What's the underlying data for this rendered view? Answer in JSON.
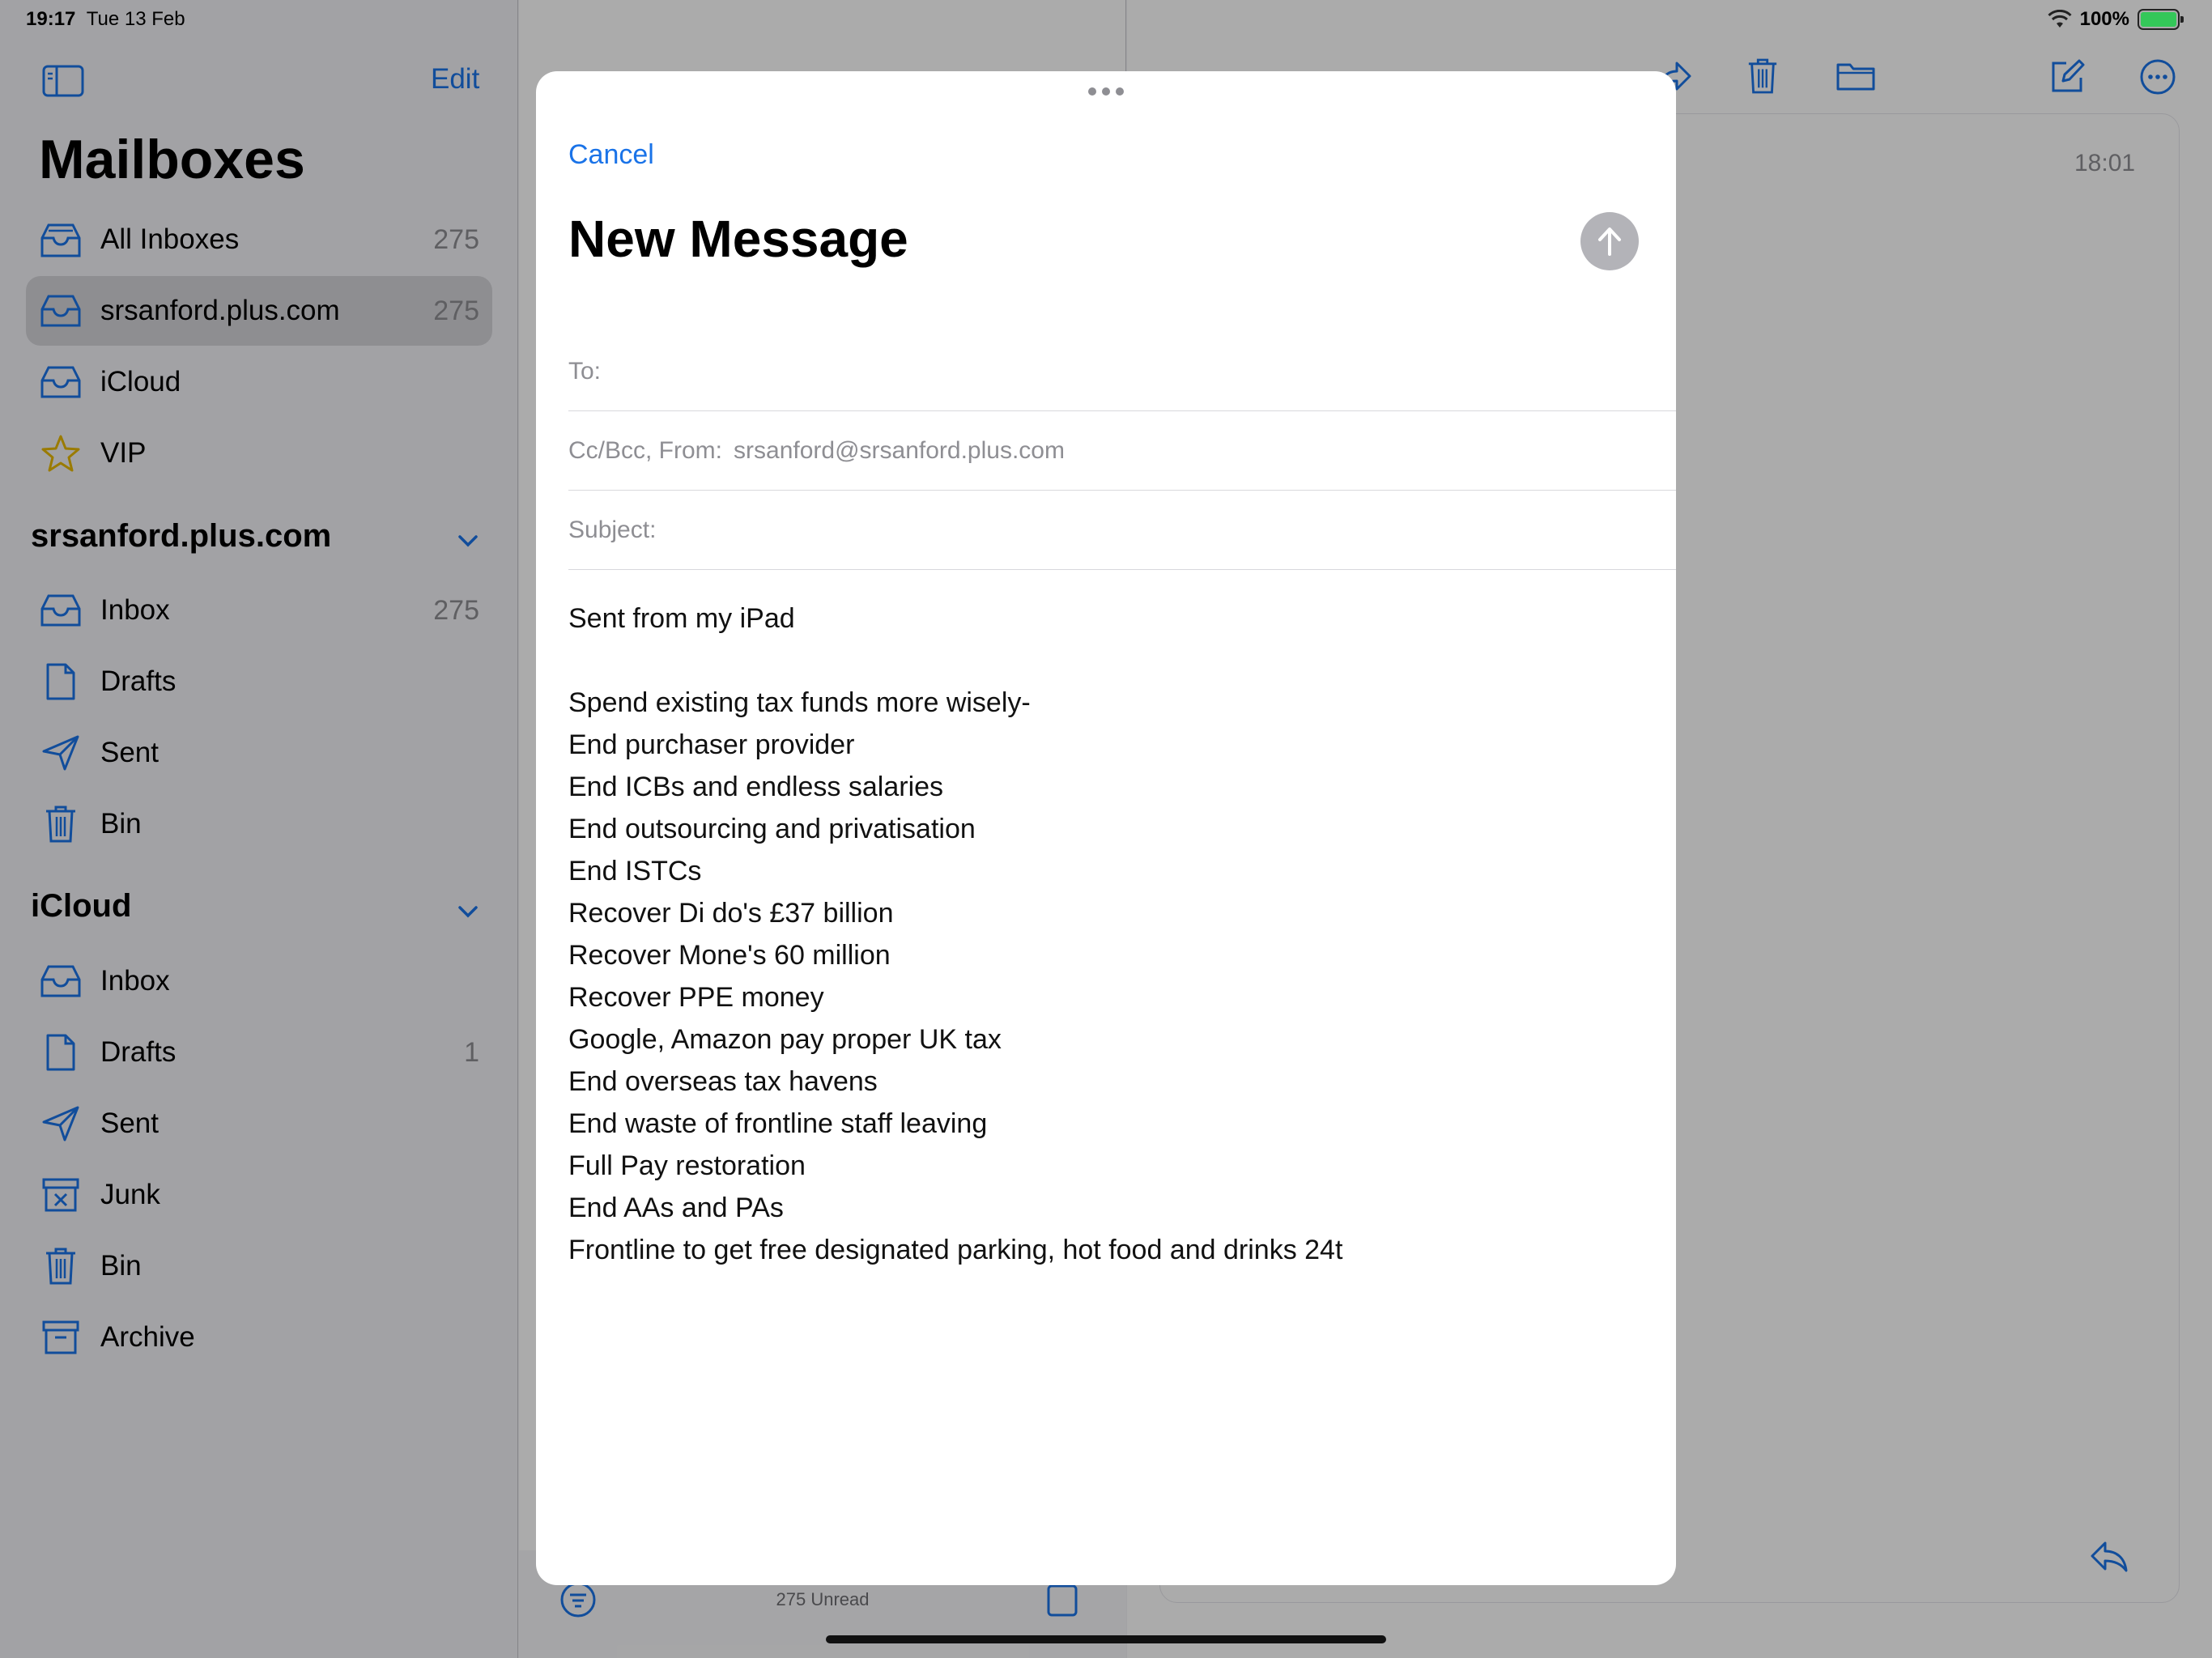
{
  "status_bar": {
    "time": "19:17",
    "date": "Tue 13 Feb",
    "battery": "100%"
  },
  "sidebar": {
    "edit": "Edit",
    "title": "Mailboxes",
    "favorites": [
      {
        "label": "All Inboxes",
        "count": "275",
        "icon": "tray-stack-icon"
      },
      {
        "label": "srsanford.plus.com",
        "count": "275",
        "icon": "tray-icon"
      },
      {
        "label": "iCloud",
        "count": "",
        "icon": "tray-icon"
      },
      {
        "label": "VIP",
        "count": "",
        "icon": "star-icon"
      }
    ],
    "accounts": [
      {
        "name": "srsanford.plus.com",
        "items": [
          {
            "label": "Inbox",
            "count": "275",
            "icon": "tray-icon"
          },
          {
            "label": "Drafts",
            "count": "",
            "icon": "document-icon"
          },
          {
            "label": "Sent",
            "count": "",
            "icon": "paperplane-icon"
          },
          {
            "label": "Bin",
            "count": "",
            "icon": "trash-icon"
          }
        ]
      },
      {
        "name": "iCloud",
        "items": [
          {
            "label": "Inbox",
            "count": "",
            "icon": "tray-icon"
          },
          {
            "label": "Drafts",
            "count": "1",
            "icon": "document-icon"
          },
          {
            "label": "Sent",
            "count": "",
            "icon": "paperplane-icon"
          },
          {
            "label": "Junk",
            "count": "",
            "icon": "junk-icon"
          },
          {
            "label": "Bin",
            "count": "",
            "icon": "trash-icon"
          },
          {
            "label": "Archive",
            "count": "",
            "icon": "archive-icon"
          }
        ]
      }
    ]
  },
  "message_list": {
    "unread": "275 Unread"
  },
  "detail": {
    "time": "18:01"
  },
  "compose": {
    "cancel": "Cancel",
    "title": "New Message",
    "to_label": "To:",
    "ccbcc_label": "Cc/Bcc, From:",
    "from_address": "srsanford@srsanford.plus.com",
    "subject_label": "Subject:",
    "body_lines": [
      "Sent from my iPad",
      "",
      "Spend existing tax funds more wisely-",
      "End purchaser provider",
      "End ICBs and endless salaries",
      "End outsourcing and privatisation",
      "End ISTCs",
      "Recover Di do's £37 billion",
      "Recover Mone's 60 million",
      "Recover PPE money",
      "Google, Amazon pay proper UK tax",
      "End overseas tax havens",
      "End waste of frontline staff leaving",
      "Full Pay restoration",
      "End AAs and PAs",
      "Frontline to get free designated parking, hot food and drinks 24t"
    ]
  }
}
